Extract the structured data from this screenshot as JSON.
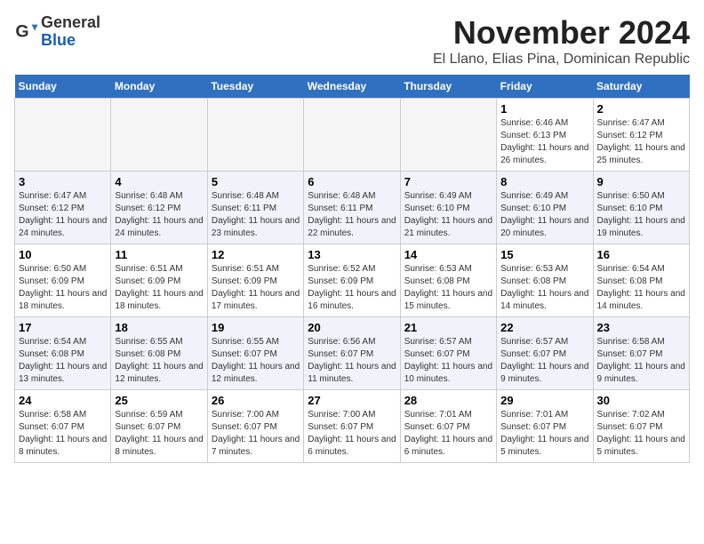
{
  "header": {
    "logo_line1": "General",
    "logo_line2": "Blue",
    "month_title": "November 2024",
    "location": "El Llano, Elias Pina, Dominican Republic"
  },
  "weekdays": [
    "Sunday",
    "Monday",
    "Tuesday",
    "Wednesday",
    "Thursday",
    "Friday",
    "Saturday"
  ],
  "weeks": [
    [
      {
        "day": "",
        "info": ""
      },
      {
        "day": "",
        "info": ""
      },
      {
        "day": "",
        "info": ""
      },
      {
        "day": "",
        "info": ""
      },
      {
        "day": "",
        "info": ""
      },
      {
        "day": "1",
        "info": "Sunrise: 6:46 AM\nSunset: 6:13 PM\nDaylight: 11 hours and 26 minutes."
      },
      {
        "day": "2",
        "info": "Sunrise: 6:47 AM\nSunset: 6:12 PM\nDaylight: 11 hours and 25 minutes."
      }
    ],
    [
      {
        "day": "3",
        "info": "Sunrise: 6:47 AM\nSunset: 6:12 PM\nDaylight: 11 hours and 24 minutes."
      },
      {
        "day": "4",
        "info": "Sunrise: 6:48 AM\nSunset: 6:12 PM\nDaylight: 11 hours and 24 minutes."
      },
      {
        "day": "5",
        "info": "Sunrise: 6:48 AM\nSunset: 6:11 PM\nDaylight: 11 hours and 23 minutes."
      },
      {
        "day": "6",
        "info": "Sunrise: 6:48 AM\nSunset: 6:11 PM\nDaylight: 11 hours and 22 minutes."
      },
      {
        "day": "7",
        "info": "Sunrise: 6:49 AM\nSunset: 6:10 PM\nDaylight: 11 hours and 21 minutes."
      },
      {
        "day": "8",
        "info": "Sunrise: 6:49 AM\nSunset: 6:10 PM\nDaylight: 11 hours and 20 minutes."
      },
      {
        "day": "9",
        "info": "Sunrise: 6:50 AM\nSunset: 6:10 PM\nDaylight: 11 hours and 19 minutes."
      }
    ],
    [
      {
        "day": "10",
        "info": "Sunrise: 6:50 AM\nSunset: 6:09 PM\nDaylight: 11 hours and 18 minutes."
      },
      {
        "day": "11",
        "info": "Sunrise: 6:51 AM\nSunset: 6:09 PM\nDaylight: 11 hours and 18 minutes."
      },
      {
        "day": "12",
        "info": "Sunrise: 6:51 AM\nSunset: 6:09 PM\nDaylight: 11 hours and 17 minutes."
      },
      {
        "day": "13",
        "info": "Sunrise: 6:52 AM\nSunset: 6:09 PM\nDaylight: 11 hours and 16 minutes."
      },
      {
        "day": "14",
        "info": "Sunrise: 6:53 AM\nSunset: 6:08 PM\nDaylight: 11 hours and 15 minutes."
      },
      {
        "day": "15",
        "info": "Sunrise: 6:53 AM\nSunset: 6:08 PM\nDaylight: 11 hours and 14 minutes."
      },
      {
        "day": "16",
        "info": "Sunrise: 6:54 AM\nSunset: 6:08 PM\nDaylight: 11 hours and 14 minutes."
      }
    ],
    [
      {
        "day": "17",
        "info": "Sunrise: 6:54 AM\nSunset: 6:08 PM\nDaylight: 11 hours and 13 minutes."
      },
      {
        "day": "18",
        "info": "Sunrise: 6:55 AM\nSunset: 6:08 PM\nDaylight: 11 hours and 12 minutes."
      },
      {
        "day": "19",
        "info": "Sunrise: 6:55 AM\nSunset: 6:07 PM\nDaylight: 11 hours and 12 minutes."
      },
      {
        "day": "20",
        "info": "Sunrise: 6:56 AM\nSunset: 6:07 PM\nDaylight: 11 hours and 11 minutes."
      },
      {
        "day": "21",
        "info": "Sunrise: 6:57 AM\nSunset: 6:07 PM\nDaylight: 11 hours and 10 minutes."
      },
      {
        "day": "22",
        "info": "Sunrise: 6:57 AM\nSunset: 6:07 PM\nDaylight: 11 hours and 9 minutes."
      },
      {
        "day": "23",
        "info": "Sunrise: 6:58 AM\nSunset: 6:07 PM\nDaylight: 11 hours and 9 minutes."
      }
    ],
    [
      {
        "day": "24",
        "info": "Sunrise: 6:58 AM\nSunset: 6:07 PM\nDaylight: 11 hours and 8 minutes."
      },
      {
        "day": "25",
        "info": "Sunrise: 6:59 AM\nSunset: 6:07 PM\nDaylight: 11 hours and 8 minutes."
      },
      {
        "day": "26",
        "info": "Sunrise: 7:00 AM\nSunset: 6:07 PM\nDaylight: 11 hours and 7 minutes."
      },
      {
        "day": "27",
        "info": "Sunrise: 7:00 AM\nSunset: 6:07 PM\nDaylight: 11 hours and 6 minutes."
      },
      {
        "day": "28",
        "info": "Sunrise: 7:01 AM\nSunset: 6:07 PM\nDaylight: 11 hours and 6 minutes."
      },
      {
        "day": "29",
        "info": "Sunrise: 7:01 AM\nSunset: 6:07 PM\nDaylight: 11 hours and 5 minutes."
      },
      {
        "day": "30",
        "info": "Sunrise: 7:02 AM\nSunset: 6:07 PM\nDaylight: 11 hours and 5 minutes."
      }
    ]
  ]
}
